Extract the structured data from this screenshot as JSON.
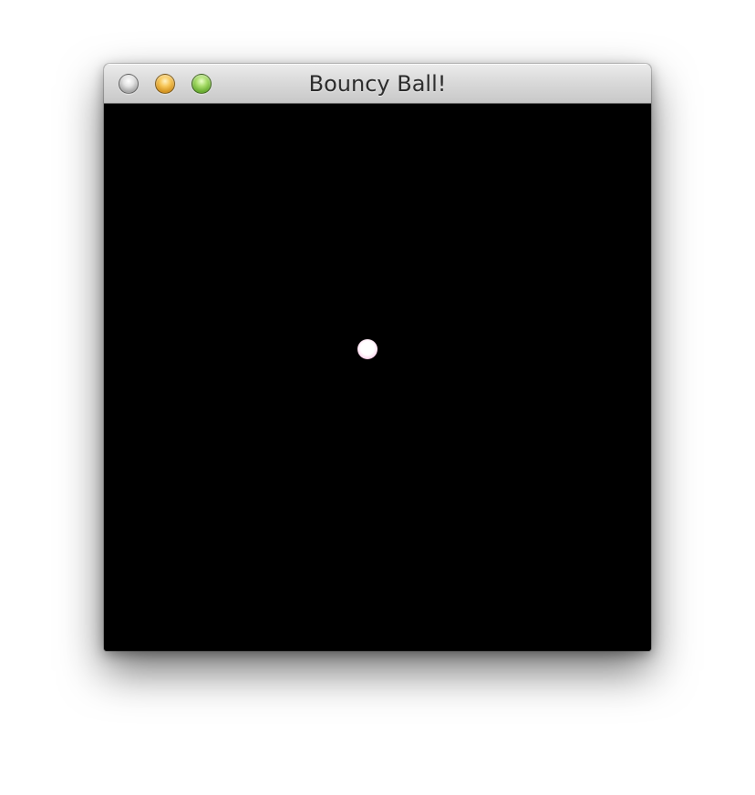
{
  "window": {
    "title": "Bouncy Ball!",
    "controls": {
      "close": {
        "color": "#b8b8b8"
      },
      "minimize": {
        "color": "#f0b43a"
      },
      "zoom": {
        "color": "#8cc852"
      }
    }
  },
  "canvas": {
    "background": "#000000",
    "ball": {
      "color": "#ffffff",
      "edge_color": "#ff9fd6"
    }
  }
}
